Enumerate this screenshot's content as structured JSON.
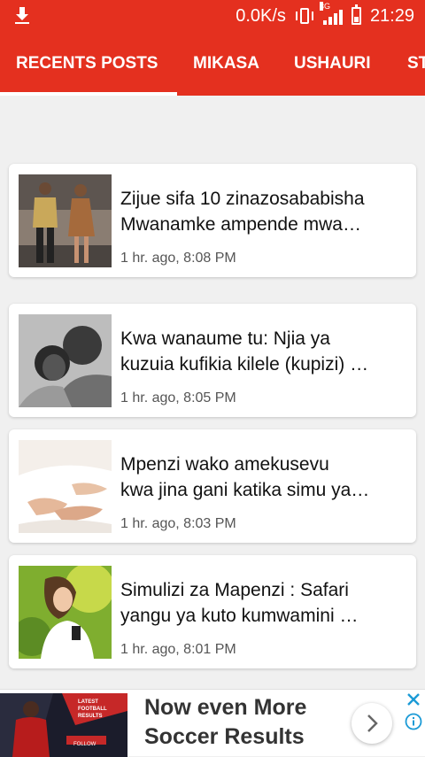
{
  "status_bar": {
    "net_speed": "0.0K/s",
    "network": "3G",
    "time": "21:29",
    "icons": [
      "download-icon",
      "vibrate-icon",
      "signal-icon",
      "battery-icon"
    ]
  },
  "tabs": [
    {
      "label": "RECENTS POSTS",
      "selected": true
    },
    {
      "label": "MIKASA",
      "selected": false
    },
    {
      "label": "USHAURI",
      "selected": false
    },
    {
      "label": "ST",
      "selected": false
    }
  ],
  "posts": [
    {
      "title_line1": "Zijue sifa 10 zinazosababisha",
      "title_line2": "Mwanamke ampende mwa…",
      "time": "1 hr. ago, 8:08 PM"
    },
    {
      "title_line1": "Kwa wanaume tu: Njia ya",
      "title_line2": "kuzuia kufikia kilele (kupizi) …",
      "time": "1 hr. ago, 8:05 PM"
    },
    {
      "title_line1": "Mpenzi wako amekusevu",
      "title_line2": "kwa jina gani katika simu ya…",
      "time": "1 hr. ago, 8:03 PM"
    },
    {
      "title_line1": "Simulizi za Mapenzi : Safari",
      "title_line2": "yangu ya kuto kumwamini …",
      "time": "1 hr. ago, 8:01 PM"
    }
  ],
  "ad": {
    "headline_line1": "Now even More",
    "headline_line2": "Soccer Results",
    "image_caption": "LATEST FOOTBALL RESULTS",
    "image_button": "FOLLOW",
    "icons": [
      "chevron-right-icon",
      "close-icon",
      "info-icon"
    ]
  },
  "colors": {
    "primary": "#e4301f",
    "background": "#f0f0f0",
    "ad_accent": "#1a9ad6"
  }
}
